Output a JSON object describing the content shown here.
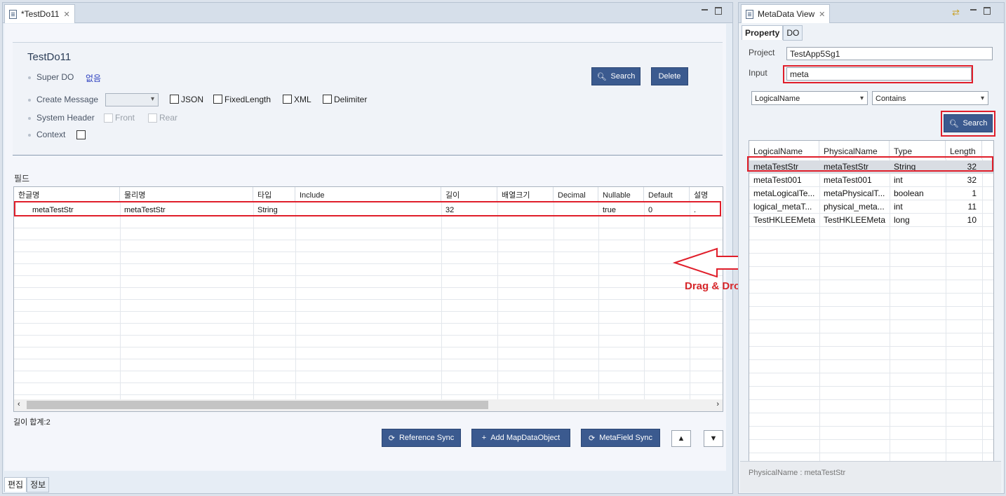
{
  "editor": {
    "tab_title": "*TestDo11",
    "form": {
      "title": "TestDo11",
      "super_do_label": "Super DO",
      "super_do_value": "없음",
      "create_message_label": "Create Message",
      "create_message_value": "",
      "options": [
        "JSON",
        "FixedLength",
        "XML",
        "Delimiter"
      ],
      "system_header_label": "System Header",
      "front_label": "Front",
      "rear_label": "Rear",
      "context_label": "Context",
      "search_button": "Search",
      "delete_button": "Delete"
    },
    "section_label": "필드",
    "columns": [
      "한글명",
      "물리명",
      "타입",
      "Include",
      "길이",
      "배열크기",
      "Decimal",
      "Nullable",
      "Default",
      "설명"
    ],
    "rows": [
      {
        "kname": "metaTestStr",
        "pname": "metaTestStr",
        "type": "String",
        "include": "",
        "length": "32",
        "array": "",
        "decimal": "",
        "nullable": "true",
        "default": "0",
        "desc": "."
      }
    ],
    "length_sum": "길이 합계:2",
    "buttons": {
      "reference_sync": "Reference Sync",
      "add_mapdataobject": "Add MapDataObject",
      "metafield_sync": "MetaField Sync"
    },
    "bottom_tabs": [
      "편집",
      "정보"
    ]
  },
  "annotation": {
    "label": "Drag & Drop",
    "color": "#e01e2a"
  },
  "meta": {
    "tab_title": "MetaData View",
    "subtabs": [
      "Property",
      "DO"
    ],
    "project_label": "Project",
    "project_value": "TestApp5Sg1",
    "input_label": "Input",
    "input_value": "meta",
    "filter_field": "LogicalName",
    "filter_mode": "Contains",
    "search_button": "Search",
    "columns": [
      "LogicalName",
      "PhysicalName",
      "Type",
      "Length"
    ],
    "rows": [
      {
        "logical": "metaTestStr",
        "physical": "metaTestStr",
        "type": "String",
        "length": "32"
      },
      {
        "logical": "metaTest001",
        "physical": "metaTest001",
        "type": "int",
        "length": "32"
      },
      {
        "logical": "metaLogicalTe...",
        "physical": "metaPhysicalT...",
        "type": "boolean",
        "length": "1"
      },
      {
        "logical": "logical_metaT...",
        "physical": "physical_meta...",
        "type": "int",
        "length": "11"
      },
      {
        "logical": "TestHKLEEMeta",
        "physical": "TestHKLEEMeta",
        "type": "long",
        "length": "10"
      }
    ],
    "status": "PhysicalName : metaTestStr"
  },
  "colors": {
    "button": "#3b5a8f",
    "highlight": "#e01e2a",
    "selected_row": "#d9dde3"
  }
}
